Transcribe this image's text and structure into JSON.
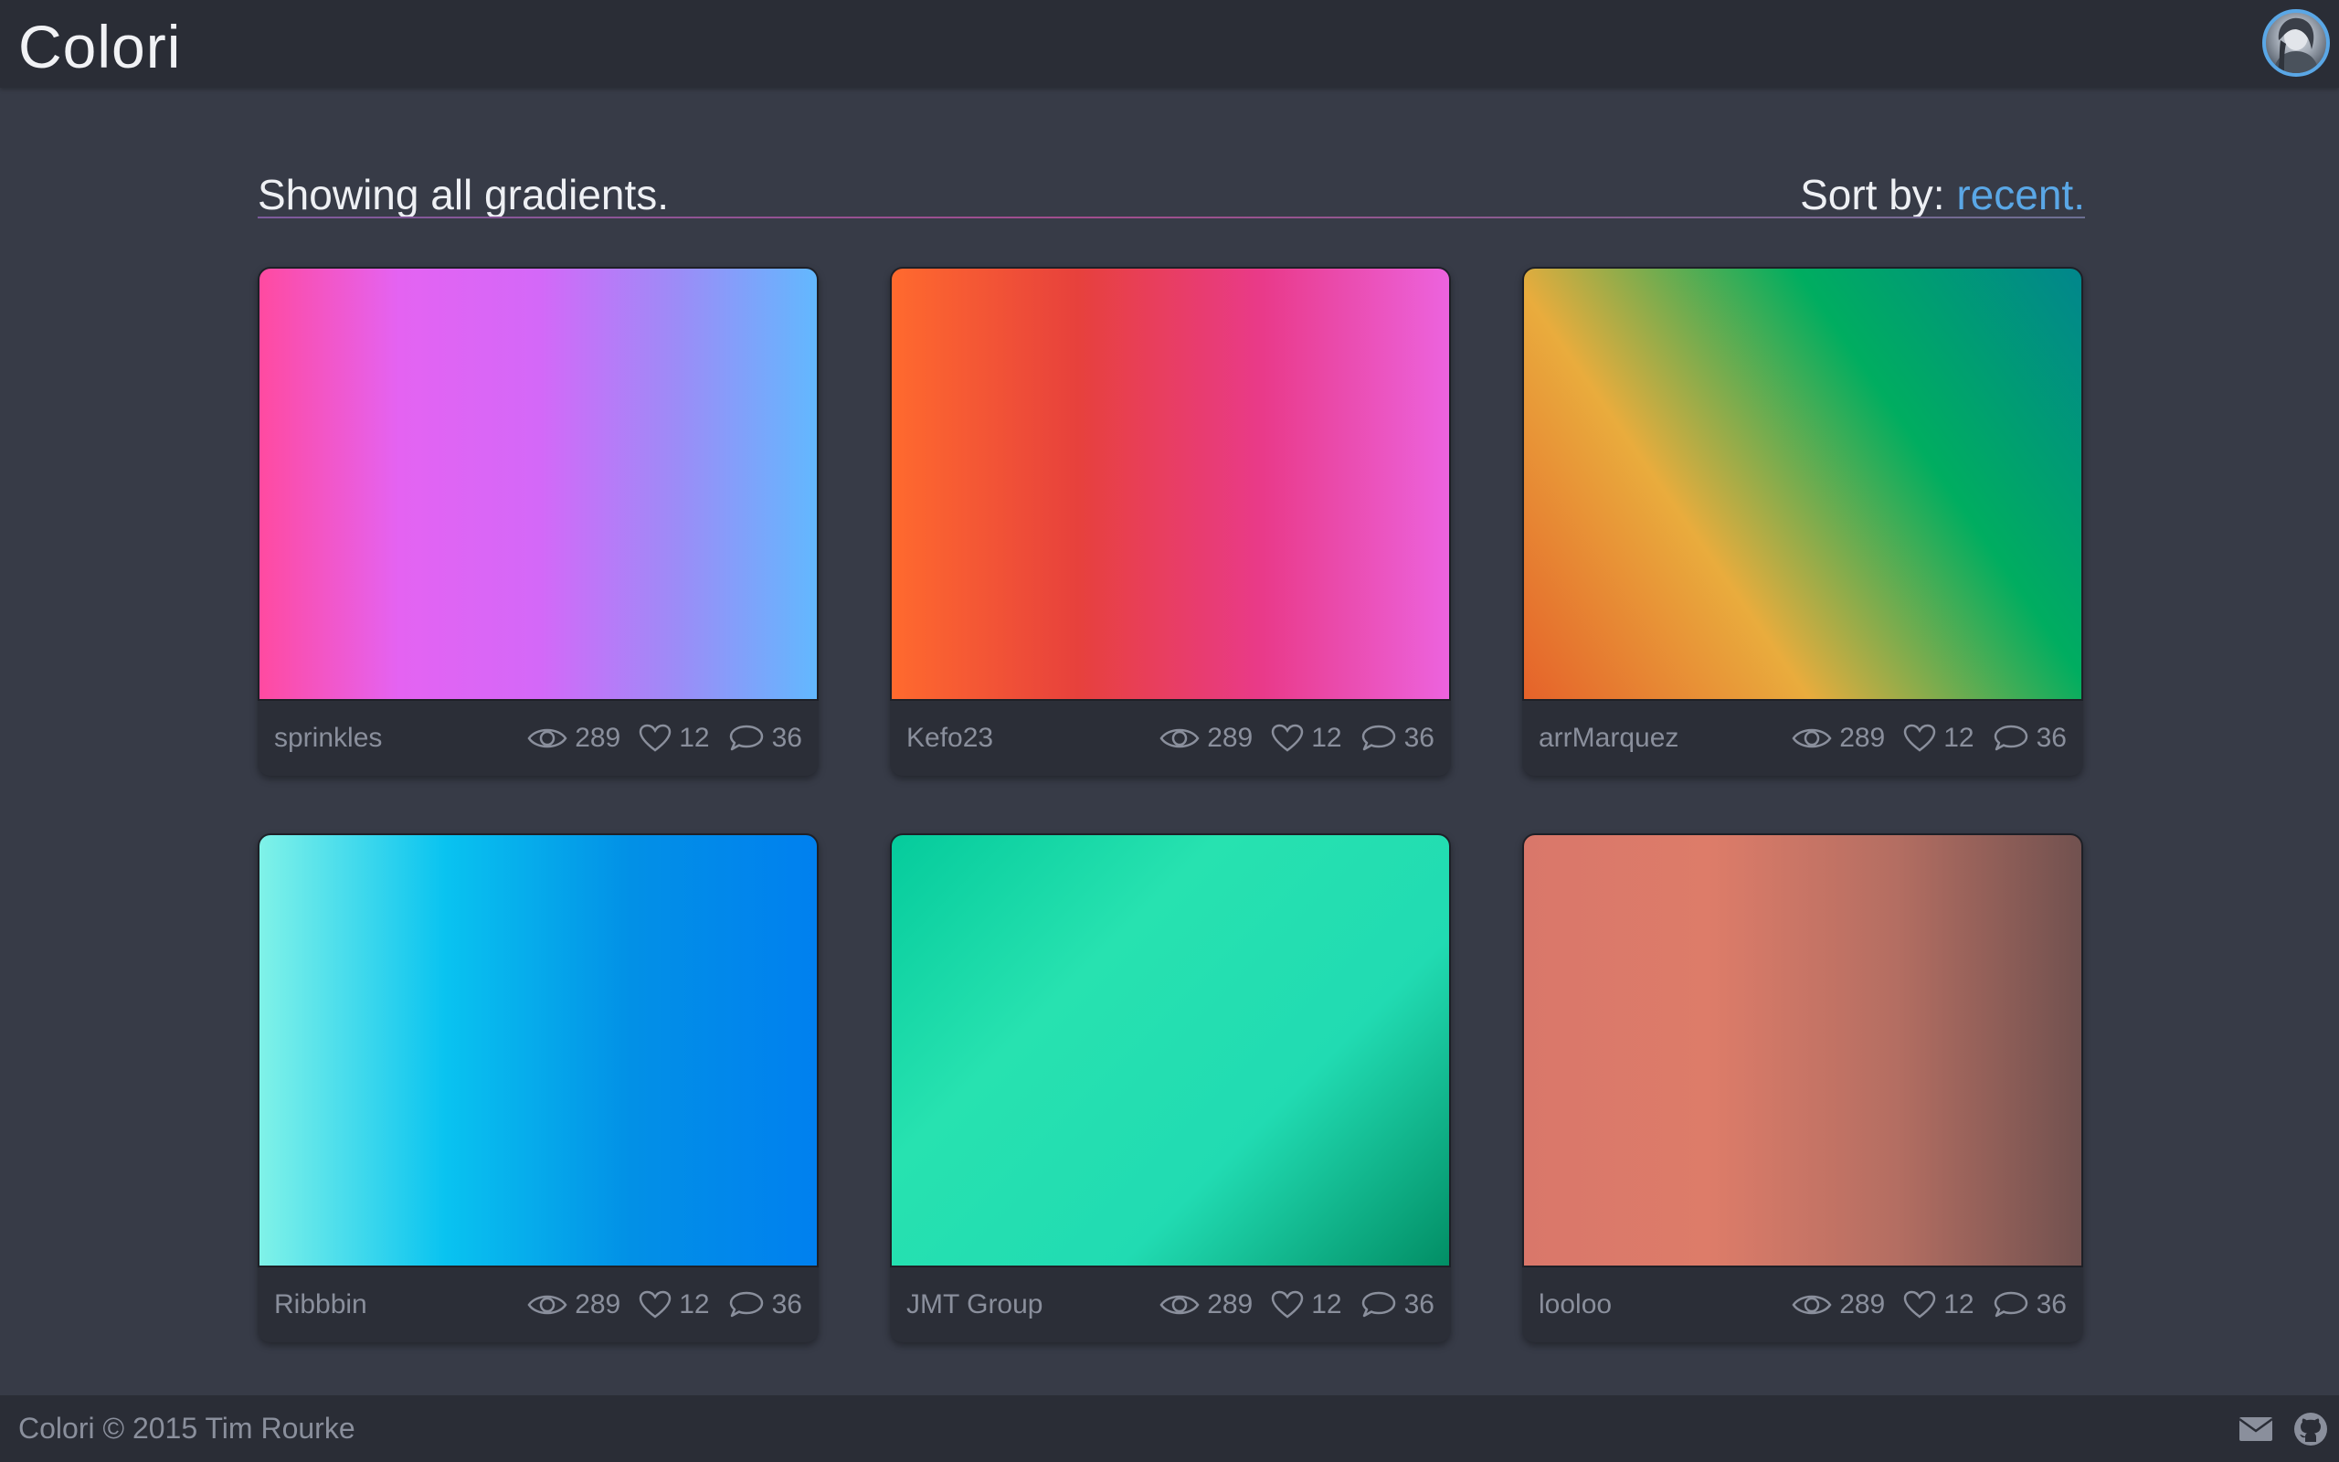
{
  "header": {
    "brand": "Colori",
    "avatar": "user-avatar"
  },
  "filter": {
    "showing_text": "Showing all gradients.",
    "sort_label": "Sort by:",
    "sort_value": "recent."
  },
  "cards": [
    {
      "author": "sprinkles",
      "views": "289",
      "likes": "12",
      "comments": "36",
      "colors": [
        "#ff4aa0",
        "#e463f2",
        "#d468f8",
        "#9c8cf7",
        "#62b8fe"
      ]
    },
    {
      "author": "Kefo23",
      "views": "289",
      "likes": "12",
      "comments": "36",
      "colors": [
        "#ff6a2e",
        "#e7413c",
        "#e93a8a",
        "#ec63de"
      ]
    },
    {
      "author": "arrMarquez",
      "views": "289",
      "likes": "12",
      "comments": "36",
      "colors": [
        "#e5622a",
        "#e9ac3d",
        "#00ad60",
        "#01868c"
      ]
    },
    {
      "author": "Ribbbin",
      "views": "289",
      "likes": "12",
      "comments": "36",
      "colors": [
        "#80f2e8",
        "#09c3f0",
        "#0290e6",
        "#0080ef"
      ]
    },
    {
      "author": "JMT Group",
      "views": "289",
      "likes": "12",
      "comments": "36",
      "colors": [
        "#05cb9c",
        "#27e2b0",
        "#21dbb2",
        "#028e65"
      ]
    },
    {
      "author": "looloo",
      "views": "289",
      "likes": "12",
      "comments": "36",
      "colors": [
        "#d9776a",
        "#dd7c69",
        "#b46e62",
        "#71514f"
      ]
    }
  ],
  "footer": {
    "copyright": "Colori © 2015 Tim Rourke",
    "icons": [
      "mail-icon",
      "github-icon"
    ]
  }
}
